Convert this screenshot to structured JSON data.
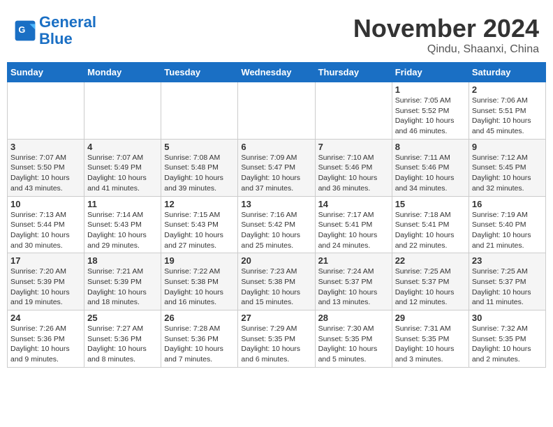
{
  "header": {
    "logo_line1": "General",
    "logo_line2": "Blue",
    "month_title": "November 2024",
    "location": "Qindu, Shaanxi, China"
  },
  "weekdays": [
    "Sunday",
    "Monday",
    "Tuesday",
    "Wednesday",
    "Thursday",
    "Friday",
    "Saturday"
  ],
  "weeks": [
    [
      {
        "day": "",
        "info": ""
      },
      {
        "day": "",
        "info": ""
      },
      {
        "day": "",
        "info": ""
      },
      {
        "day": "",
        "info": ""
      },
      {
        "day": "",
        "info": ""
      },
      {
        "day": "1",
        "info": "Sunrise: 7:05 AM\nSunset: 5:52 PM\nDaylight: 10 hours and 46 minutes."
      },
      {
        "day": "2",
        "info": "Sunrise: 7:06 AM\nSunset: 5:51 PM\nDaylight: 10 hours and 45 minutes."
      }
    ],
    [
      {
        "day": "3",
        "info": "Sunrise: 7:07 AM\nSunset: 5:50 PM\nDaylight: 10 hours and 43 minutes."
      },
      {
        "day": "4",
        "info": "Sunrise: 7:07 AM\nSunset: 5:49 PM\nDaylight: 10 hours and 41 minutes."
      },
      {
        "day": "5",
        "info": "Sunrise: 7:08 AM\nSunset: 5:48 PM\nDaylight: 10 hours and 39 minutes."
      },
      {
        "day": "6",
        "info": "Sunrise: 7:09 AM\nSunset: 5:47 PM\nDaylight: 10 hours and 37 minutes."
      },
      {
        "day": "7",
        "info": "Sunrise: 7:10 AM\nSunset: 5:46 PM\nDaylight: 10 hours and 36 minutes."
      },
      {
        "day": "8",
        "info": "Sunrise: 7:11 AM\nSunset: 5:46 PM\nDaylight: 10 hours and 34 minutes."
      },
      {
        "day": "9",
        "info": "Sunrise: 7:12 AM\nSunset: 5:45 PM\nDaylight: 10 hours and 32 minutes."
      }
    ],
    [
      {
        "day": "10",
        "info": "Sunrise: 7:13 AM\nSunset: 5:44 PM\nDaylight: 10 hours and 30 minutes."
      },
      {
        "day": "11",
        "info": "Sunrise: 7:14 AM\nSunset: 5:43 PM\nDaylight: 10 hours and 29 minutes."
      },
      {
        "day": "12",
        "info": "Sunrise: 7:15 AM\nSunset: 5:43 PM\nDaylight: 10 hours and 27 minutes."
      },
      {
        "day": "13",
        "info": "Sunrise: 7:16 AM\nSunset: 5:42 PM\nDaylight: 10 hours and 25 minutes."
      },
      {
        "day": "14",
        "info": "Sunrise: 7:17 AM\nSunset: 5:41 PM\nDaylight: 10 hours and 24 minutes."
      },
      {
        "day": "15",
        "info": "Sunrise: 7:18 AM\nSunset: 5:41 PM\nDaylight: 10 hours and 22 minutes."
      },
      {
        "day": "16",
        "info": "Sunrise: 7:19 AM\nSunset: 5:40 PM\nDaylight: 10 hours and 21 minutes."
      }
    ],
    [
      {
        "day": "17",
        "info": "Sunrise: 7:20 AM\nSunset: 5:39 PM\nDaylight: 10 hours and 19 minutes."
      },
      {
        "day": "18",
        "info": "Sunrise: 7:21 AM\nSunset: 5:39 PM\nDaylight: 10 hours and 18 minutes."
      },
      {
        "day": "19",
        "info": "Sunrise: 7:22 AM\nSunset: 5:38 PM\nDaylight: 10 hours and 16 minutes."
      },
      {
        "day": "20",
        "info": "Sunrise: 7:23 AM\nSunset: 5:38 PM\nDaylight: 10 hours and 15 minutes."
      },
      {
        "day": "21",
        "info": "Sunrise: 7:24 AM\nSunset: 5:37 PM\nDaylight: 10 hours and 13 minutes."
      },
      {
        "day": "22",
        "info": "Sunrise: 7:25 AM\nSunset: 5:37 PM\nDaylight: 10 hours and 12 minutes."
      },
      {
        "day": "23",
        "info": "Sunrise: 7:25 AM\nSunset: 5:37 PM\nDaylight: 10 hours and 11 minutes."
      }
    ],
    [
      {
        "day": "24",
        "info": "Sunrise: 7:26 AM\nSunset: 5:36 PM\nDaylight: 10 hours and 9 minutes."
      },
      {
        "day": "25",
        "info": "Sunrise: 7:27 AM\nSunset: 5:36 PM\nDaylight: 10 hours and 8 minutes."
      },
      {
        "day": "26",
        "info": "Sunrise: 7:28 AM\nSunset: 5:36 PM\nDaylight: 10 hours and 7 minutes."
      },
      {
        "day": "27",
        "info": "Sunrise: 7:29 AM\nSunset: 5:35 PM\nDaylight: 10 hours and 6 minutes."
      },
      {
        "day": "28",
        "info": "Sunrise: 7:30 AM\nSunset: 5:35 PM\nDaylight: 10 hours and 5 minutes."
      },
      {
        "day": "29",
        "info": "Sunrise: 7:31 AM\nSunset: 5:35 PM\nDaylight: 10 hours and 3 minutes."
      },
      {
        "day": "30",
        "info": "Sunrise: 7:32 AM\nSunset: 5:35 PM\nDaylight: 10 hours and 2 minutes."
      }
    ]
  ]
}
